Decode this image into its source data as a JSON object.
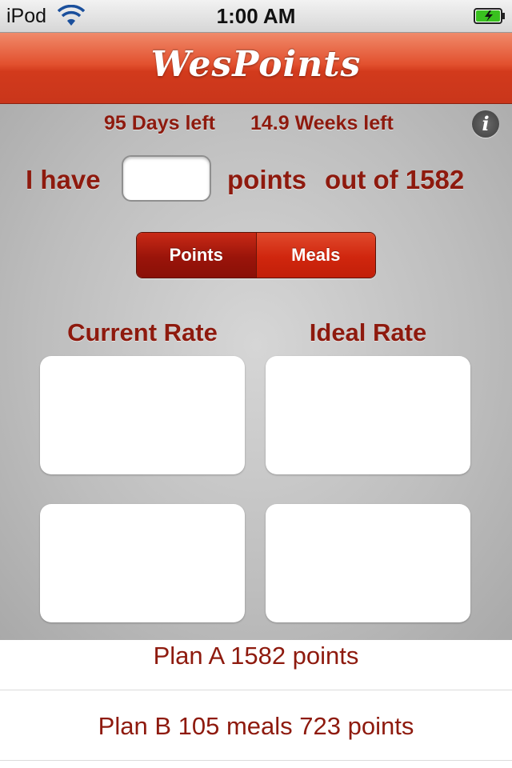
{
  "status_bar": {
    "carrier": "iPod",
    "time": "1:00 AM",
    "wifi_icon": "wifi-icon",
    "battery_icon": "battery-charging-icon",
    "battery_color": "#39c11f"
  },
  "nav": {
    "title": "WesPoints",
    "color": "#d23a1c"
  },
  "countdown": {
    "days": "95 Days left",
    "weeks": "14.9 Weeks left",
    "info_icon": "info-icon",
    "info_glyph": "i"
  },
  "points_row": {
    "prefix": "I have",
    "input_value": "",
    "label": "points",
    "out_of": "out of 1582"
  },
  "segmented": {
    "options": [
      "Points",
      "Meals"
    ],
    "selected": "Points"
  },
  "rates": {
    "current_label": "Current Rate",
    "ideal_label": "Ideal Rate",
    "current_top": "",
    "ideal_top": "",
    "current_bottom": "",
    "ideal_bottom": ""
  },
  "plans": [
    {
      "label": "Plan A 1582 points"
    },
    {
      "label": "Plan B 105 meals 723 points"
    }
  ],
  "colors": {
    "accent_text": "#8e1a0e",
    "background": "#bdbdbd"
  }
}
